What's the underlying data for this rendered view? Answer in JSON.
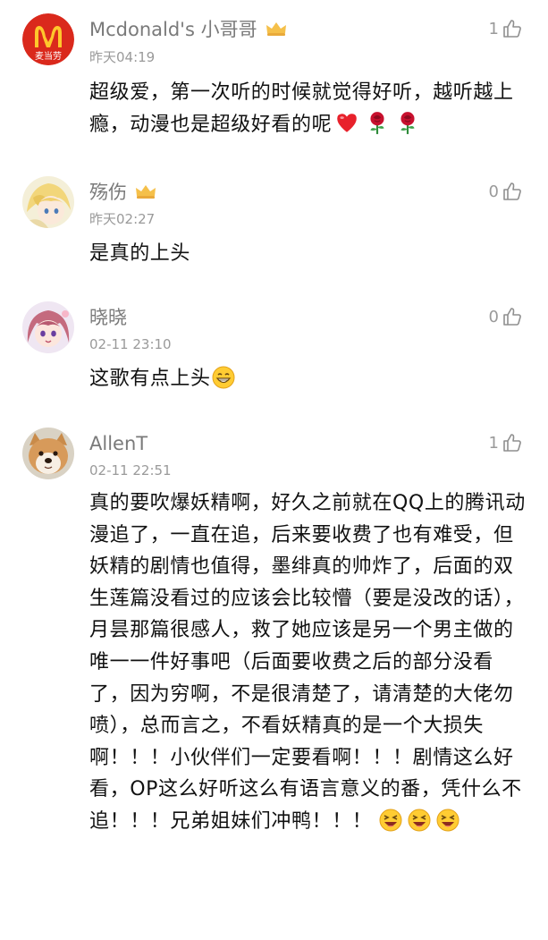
{
  "comments": [
    {
      "user": "Mcdonald's 小哥哥",
      "avatar_label": "麦当劳",
      "time": "昨天04:19",
      "likes": "1",
      "text": "超级爱，第一次听的时候就觉得好听，越听越上瘾，动漫也是超级好看的呢"
    },
    {
      "user": "殇伤",
      "time": "昨天02:27",
      "likes": "0",
      "text": "是真的上头"
    },
    {
      "user": "晓晓",
      "time": "02-11 23:10",
      "likes": "0",
      "text": "这歌有点上头"
    },
    {
      "user": "AllenT",
      "time": "02-11 22:51",
      "likes": "1",
      "text": "真的要吹爆妖精啊，好久之前就在QQ上的腾讯动漫追了，一直在追，后来要收费了也有难受，但妖精的剧情也值得，墨绯真的帅炸了，后面的双生莲篇没看过的应该会比较懵（要是没改的话），月昙那篇很感人，救了她应该是另一个男主做的唯一一件好事吧（后面要收费之后的部分没看了，因为穷啊，不是很清楚了，请清楚的大佬勿喷），总而言之，不看妖精真的是一个大损失啊！！！小伙伴们一定要看啊！！！剧情这么好看，OP这么好听这么有语言意义的番，凭什么不追！！！兄弟姐妹们冲鸭！！！"
    }
  ],
  "colors": {
    "accent_red": "#DA291C",
    "logo_yellow": "#FFC72C",
    "text": "#111111",
    "muted": "#9a9a9a"
  },
  "icons": [
    "thumbs-up-icon",
    "vip-badge-icon",
    "heart-emoji",
    "rose-emoji",
    "grin-emoji",
    "laugh-emoji"
  ]
}
